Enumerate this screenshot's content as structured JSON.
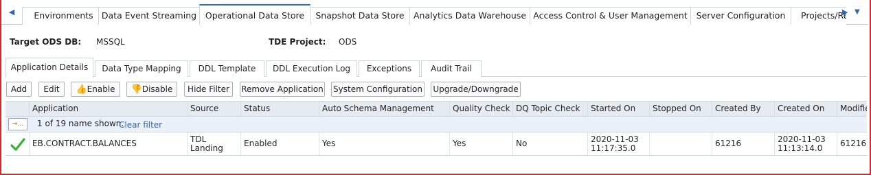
{
  "top_tabs": {
    "items": [
      "Environments",
      "Data Event Streaming",
      "Operational Data Store",
      "Snapshot Data Store",
      "Analytics Data Warehouse",
      "Access Control & User Management",
      "Server Configuration",
      "Projects/Re"
    ],
    "active": "Operational Data Store"
  },
  "info": {
    "target_label": "Target ODS DB:",
    "target_value": "MSSQL",
    "project_label": "TDE Project:",
    "project_value": "ODS"
  },
  "sub_tabs": {
    "items": [
      "Application Details",
      "Data Type Mapping",
      "DDL Template",
      "DDL Execution Log",
      "Exceptions",
      "Audit Trail"
    ],
    "active": "Application Details"
  },
  "toolbar": {
    "add": "Add",
    "edit": "Edit",
    "enable": "Enable",
    "disable": "Disable",
    "hide_filter": "Hide Filter",
    "remove_application": "Remove Application",
    "system_configuration": "System Configuration",
    "upgrade_downgrade": "Upgrade/Downgrade"
  },
  "grid": {
    "columns": [
      "Application",
      "Source",
      "Status",
      "Auto Schema Management",
      "Quality Check",
      "DQ Topic Check",
      "Started On",
      "Stopped On",
      "Created By",
      "Created On",
      "Modifie"
    ],
    "filter_summary": "1 of 19 name shown.",
    "clear_filter": "Clear filter",
    "rows": [
      {
        "application": "EB.CONTRACT.BALANCES",
        "source": "TDL Landing",
        "status": "Enabled",
        "auto_schema": "Yes",
        "quality_check": "Yes",
        "dq_topic_check": "No",
        "started_on": "2020-11-03 11:17:35.0",
        "stopped_on": "",
        "created_by": "61216",
        "created_on": "2020-11-03 11:13:14.0",
        "modified": "61216"
      }
    ]
  },
  "colors": {
    "accent": "#2f69b4",
    "frame": "#d62a2a",
    "check": "#2fb52f"
  }
}
